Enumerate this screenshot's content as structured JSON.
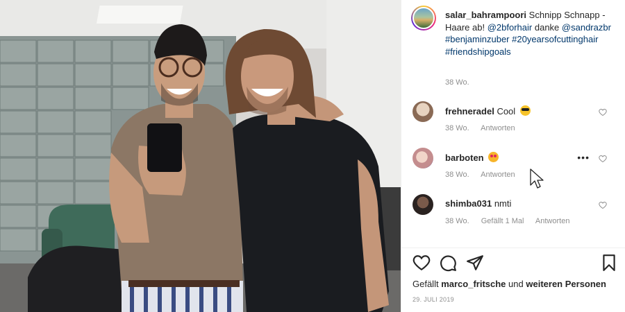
{
  "post": {
    "author": "salar_bahrampoori",
    "caption_text_1": "Schnipp Schnapp - Haare ab!",
    "mention_1": "@2bforhair",
    "caption_text_2": "danke",
    "mention_2": "@sandrazbr",
    "hashtag_1": "#benjaminzuber",
    "hashtag_2": "#20yearsofcuttinghair",
    "hashtag_3": "#friendshipgoals",
    "time": "38 Wo."
  },
  "comments": [
    {
      "user": "frehneradel",
      "text": "Cool",
      "emoji": "cool-sunglasses-emoji",
      "time": "38 Wo.",
      "reply": "Antworten",
      "likes": ""
    },
    {
      "user": "barboten",
      "text": "",
      "emoji": "heart-eyes-emoji",
      "time": "38 Wo.",
      "reply": "Antworten",
      "likes": "",
      "more": "•••"
    },
    {
      "user": "shimba031",
      "text": "nmti",
      "emoji": "",
      "time": "38 Wo.",
      "reply": "Antworten",
      "likes": "Gefällt 1 Mal"
    }
  ],
  "likes": {
    "prefix": "Gefällt",
    "user": "marco_fritsche",
    "middle": "und",
    "suffix": "weiteren Personen"
  },
  "date": "29. JULI 2019",
  "icons": [
    "heart-icon",
    "comment-icon",
    "share-icon",
    "bookmark-icon",
    "mouse-cursor-icon"
  ],
  "colors": {
    "link": "#00376b",
    "muted": "#8e8e8e",
    "text": "#262626"
  }
}
